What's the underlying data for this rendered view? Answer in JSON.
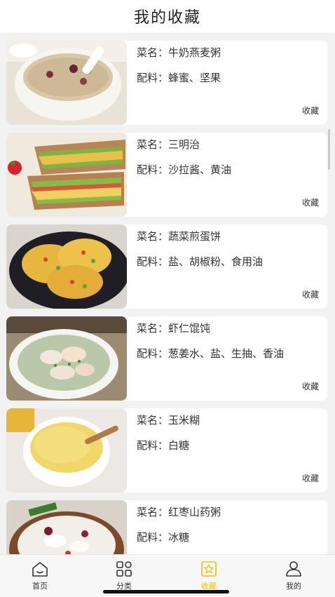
{
  "header": {
    "title": "我的收藏"
  },
  "labels": {
    "name_prefix": "菜名：",
    "ing_prefix": "配料："
  },
  "items": [
    {
      "name": "牛奶燕麦粥",
      "ingredients": "蜂蜜、坚果",
      "fav": "收藏"
    },
    {
      "name": "三明治",
      "ingredients": "沙拉酱、黄油",
      "fav": "收藏"
    },
    {
      "name": "蔬菜煎蛋饼",
      "ingredients": "盐、胡椒粉、食用油",
      "fav": "收藏"
    },
    {
      "name": "虾仁馄饨",
      "ingredients": "葱姜水、盐、生抽、香油",
      "fav": "收藏"
    },
    {
      "name": "玉米糊",
      "ingredients": "白糖",
      "fav": "收藏"
    },
    {
      "name": "红枣山药粥",
      "ingredients": "冰糖",
      "fav": "收藏"
    }
  ],
  "tabs": [
    {
      "label": "首页",
      "icon": "home-icon"
    },
    {
      "label": "分类",
      "icon": "category-grid-icon"
    },
    {
      "label": "收藏",
      "icon": "favorite-star-icon",
      "active": true
    },
    {
      "label": "我的",
      "icon": "profile-icon"
    }
  ],
  "colors": {
    "accent": "#f0c000",
    "background": "#f2f2f2",
    "card": "#ffffff"
  }
}
